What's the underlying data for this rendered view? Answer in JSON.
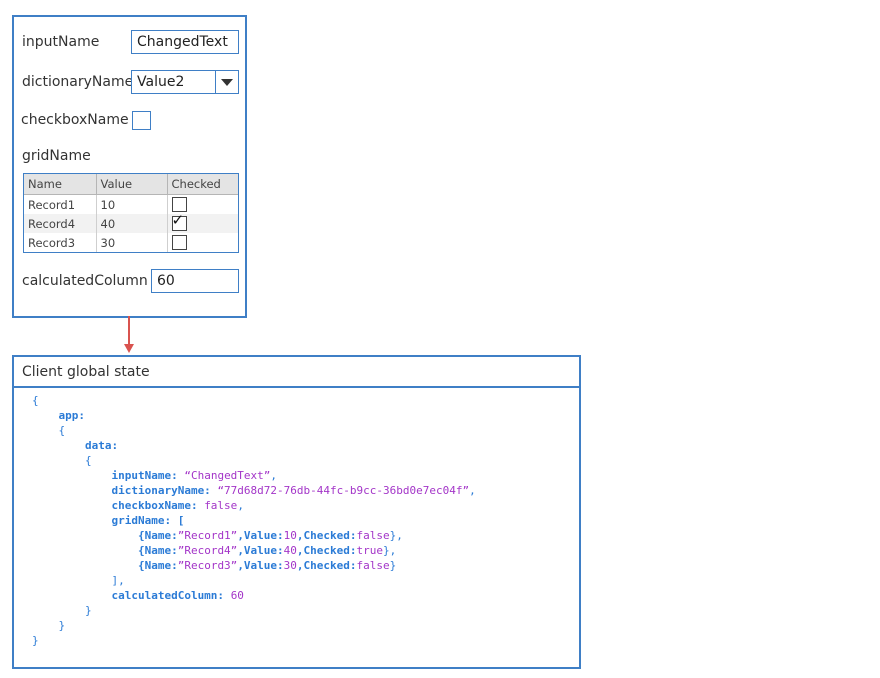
{
  "form": {
    "input_label": "inputName",
    "input_value": "ChangedText",
    "dictionary_label": "dictionaryName",
    "dictionary_value": "Value2",
    "checkbox_label": "checkboxName",
    "checkbox_checked": false,
    "grid_label": "gridName",
    "grid": {
      "columns": [
        "Name",
        "Value",
        "Checked"
      ],
      "rows": [
        {
          "name": "Record1",
          "value": "10",
          "checked": false
        },
        {
          "name": "Record4",
          "value": "40",
          "checked": true
        },
        {
          "name": "Record3",
          "value": "30",
          "checked": false
        }
      ]
    },
    "calculated_label": "calculatedColumn",
    "calculated_value": "60"
  },
  "state": {
    "title": "Client global state",
    "code_lines": [
      [
        {
          "t": "{",
          "c": "p"
        }
      ],
      [
        {
          "t": "    app:",
          "c": "k"
        }
      ],
      [
        {
          "t": "    {",
          "c": "p"
        }
      ],
      [
        {
          "t": "        data:",
          "c": "k"
        }
      ],
      [
        {
          "t": "        {",
          "c": "p"
        }
      ],
      [
        {
          "t": "            inputName: ",
          "c": "k"
        },
        {
          "t": "“ChangedText”",
          "c": "s"
        },
        {
          "t": ",",
          "c": "p"
        }
      ],
      [
        {
          "t": "            dictionaryName: ",
          "c": "k"
        },
        {
          "t": "“77d68d72-76db-44fc-b9cc-36bd0e7ec04f”",
          "c": "s"
        },
        {
          "t": ",",
          "c": "p"
        }
      ],
      [
        {
          "t": "            checkboxName: ",
          "c": "k"
        },
        {
          "t": "false",
          "c": "v"
        },
        {
          "t": ",",
          "c": "p"
        }
      ],
      [
        {
          "t": "            gridName: [",
          "c": "k"
        }
      ],
      [
        {
          "t": "                {Name:",
          "c": "k"
        },
        {
          "t": "”Record1”",
          "c": "s"
        },
        {
          "t": ",Value:",
          "c": "k"
        },
        {
          "t": "10",
          "c": "v"
        },
        {
          "t": ",Checked:",
          "c": "k"
        },
        {
          "t": "false",
          "c": "v"
        },
        {
          "t": "},",
          "c": "p"
        }
      ],
      [
        {
          "t": "                {Name:",
          "c": "k"
        },
        {
          "t": "”Record4”",
          "c": "s"
        },
        {
          "t": ",Value:",
          "c": "k"
        },
        {
          "t": "40",
          "c": "v"
        },
        {
          "t": ",Checked:",
          "c": "k"
        },
        {
          "t": "true",
          "c": "v"
        },
        {
          "t": "},",
          "c": "p"
        }
      ],
      [
        {
          "t": "                {Name:",
          "c": "k"
        },
        {
          "t": "”Record3”",
          "c": "s"
        },
        {
          "t": ",Value:",
          "c": "k"
        },
        {
          "t": "30",
          "c": "v"
        },
        {
          "t": ",Checked:",
          "c": "k"
        },
        {
          "t": "false",
          "c": "v"
        },
        {
          "t": "}",
          "c": "p"
        }
      ],
      [
        {
          "t": "            ],",
          "c": "p"
        }
      ],
      [
        {
          "t": "            calculatedColumn: ",
          "c": "k"
        },
        {
          "t": "60",
          "c": "v"
        }
      ],
      [
        {
          "t": "        }",
          "c": "p"
        }
      ],
      [
        {
          "t": "    }",
          "c": "p"
        }
      ],
      [
        {
          "t": "}",
          "c": "p"
        }
      ]
    ]
  },
  "colors": {
    "border": "#3f7fc6",
    "arrow": "#d9534f",
    "key": "#2b7bd6",
    "value": "#a335c8"
  }
}
